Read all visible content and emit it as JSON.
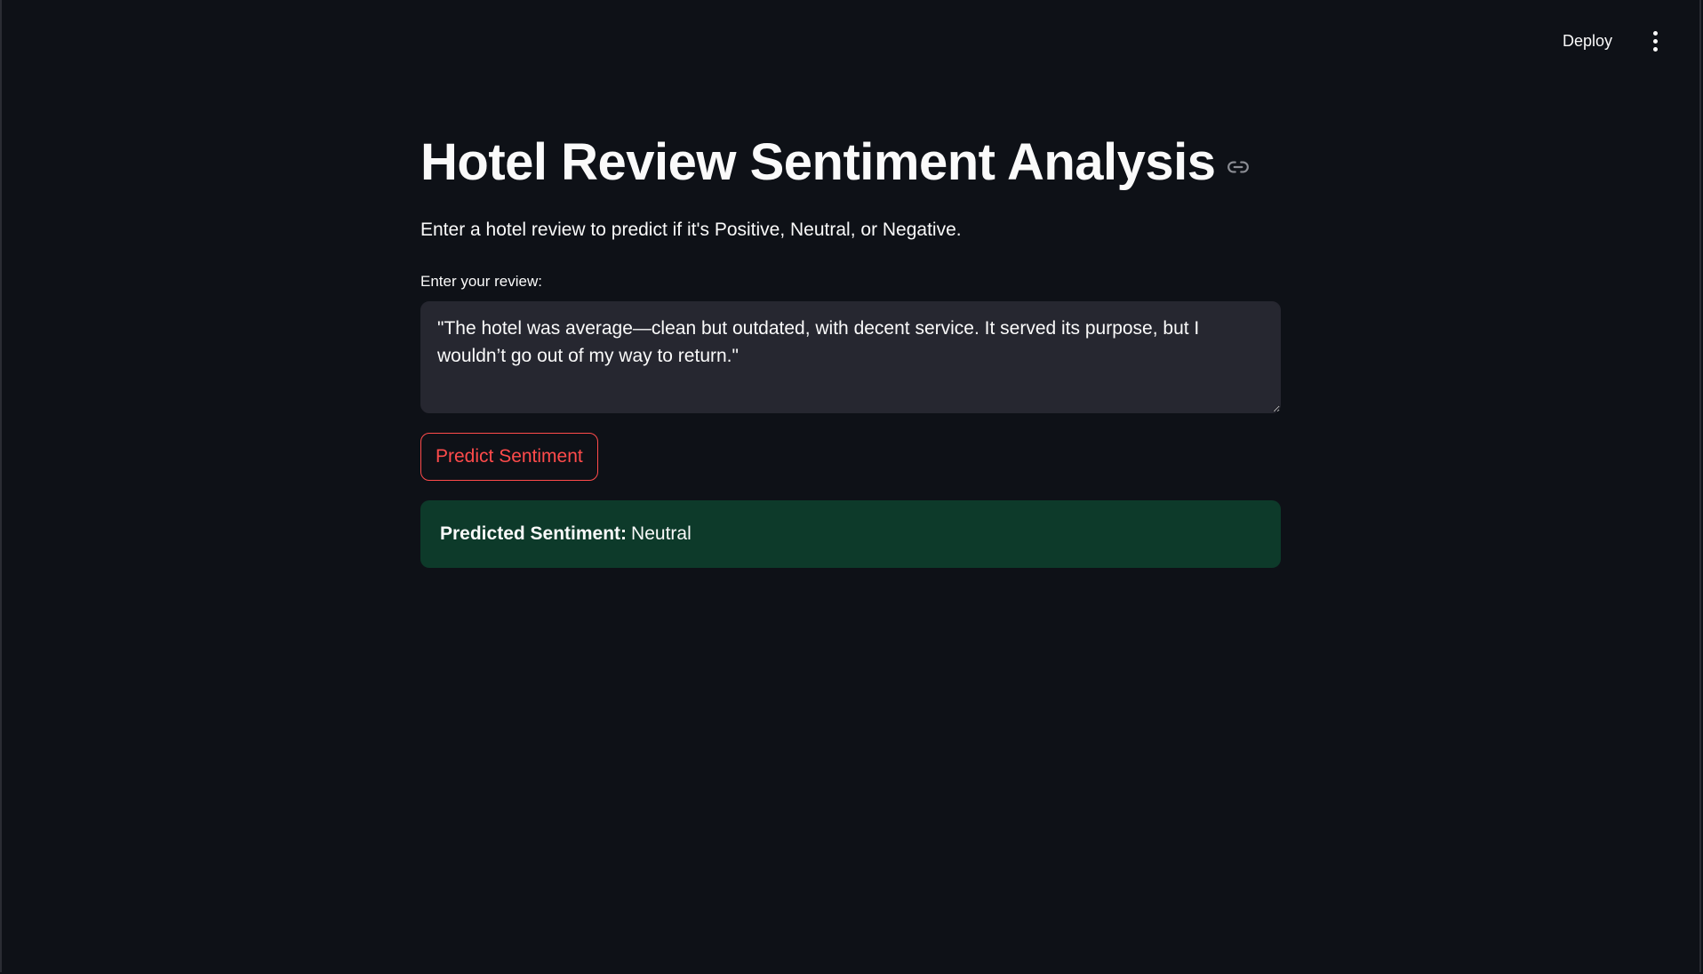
{
  "header": {
    "deploy_label": "Deploy",
    "menu_icon": "more-vertical-icon"
  },
  "main": {
    "title": "Hotel Review Sentiment Analysis",
    "title_icon": "link-icon",
    "subtitle": "Enter a hotel review to predict if it's Positive, Neutral, or Negative.",
    "review_label": "Enter your review:",
    "review_value": "\"The hotel was average—clean but outdated, with decent service. It served its purpose, but I wouldn’t go out of my way to return.\"",
    "predict_button_label": "Predict Sentiment",
    "result": {
      "label": "Predicted Sentiment:",
      "value": "Neutral"
    }
  },
  "colors": {
    "background": "#0e1117",
    "textarea_bg": "#262730",
    "accent": "#ff4b4b",
    "success_bg": "#0d3a2a"
  }
}
